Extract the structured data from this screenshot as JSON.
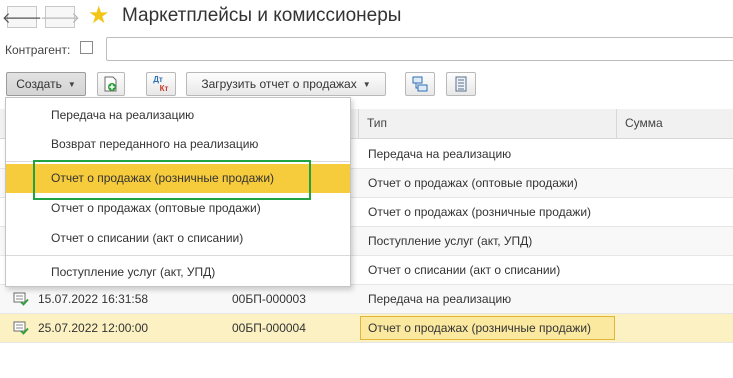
{
  "window": {
    "back_glyph": "🡐",
    "forward_glyph": "🡒",
    "star_glyph": "★",
    "title": "Маркетплейсы и комиссионеры"
  },
  "filter": {
    "label": "Контрагент:",
    "checked": false,
    "value": ""
  },
  "toolbar": {
    "create_label": "Создать",
    "load_report_label": "Загрузить отчет о продажах",
    "dtkt_top": "Дт",
    "dtkt_bottom": "Кт"
  },
  "create_menu": {
    "items": [
      "Передача на реализацию",
      "Возврат переданного на реализацию",
      "Отчет о продажах (розничные продажи)",
      "Отчет о продажах (оптовые продажи)",
      "Отчет о списании (акт о списании)",
      "Поступление услуг (акт, УПД)"
    ],
    "highlighted_index": 2
  },
  "table": {
    "columns": [
      "Тип",
      "Сумма"
    ],
    "rows": [
      {
        "date": "",
        "number": "",
        "type": "Передача на реализацию",
        "amount": ""
      },
      {
        "date": "",
        "number": "",
        "type": "Отчет о продажах (оптовые продажи)",
        "amount": ""
      },
      {
        "date": "",
        "number": "",
        "type": "Отчет о продажах (розничные продажи)",
        "amount": ""
      },
      {
        "date": "",
        "number": "",
        "type": "Поступление услуг (акт, УПД)",
        "amount": ""
      },
      {
        "date": "",
        "number": "",
        "type": "Отчет о списании (акт о списании)",
        "amount": ""
      },
      {
        "date": "15.07.2022 16:31:58",
        "number": "00БП-000003",
        "type": "Передача на реализацию",
        "amount": ""
      },
      {
        "date": "25.07.2022 12:00:00",
        "number": "00БП-000004",
        "type": "Отчет о продажах (розничные продажи)",
        "amount": ""
      }
    ],
    "selected_row_index": 6
  },
  "colors": {
    "accent_yellow": "#f6cb3c",
    "selection_row": "#fbf1c2",
    "highlight_frame_green": "#1fa343",
    "star_yellow": "#f2c618"
  }
}
